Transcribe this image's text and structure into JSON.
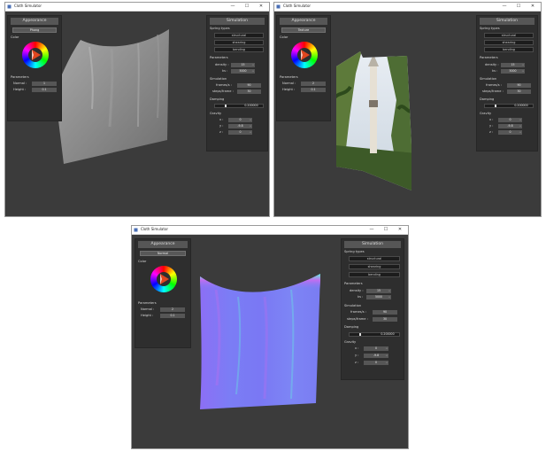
{
  "windows": [
    {
      "title": "Cloth Simulator",
      "shading": "Phong",
      "buttons": {
        "minimize": "—",
        "maximize": "☐",
        "close": "✕"
      },
      "appearance": {
        "title": "Appearance",
        "color_label": "Color",
        "parameters_label": "Parameters",
        "normal_label": "Normal :",
        "normal_value": "1",
        "height_label": "Height :",
        "height_value": "0.1"
      },
      "simulation": {
        "title": "Simulation",
        "spring_types_label": "Spring types",
        "spring_buttons": [
          "structural",
          "shearing",
          "bending"
        ],
        "parameters_label": "Parameters",
        "density_label": "density :",
        "density_value": "15",
        "ks_label": "ks :",
        "ks_value": "5000",
        "simulation_label": "Simulation",
        "frames_label": "frames/s :",
        "frames_value": "90",
        "steps_label": "steps/frame :",
        "steps_value": "30",
        "damping_label": "Damping",
        "damping_value": "0.200000",
        "gravity_label": "Gravity",
        "gravity": [
          {
            "label": "x :",
            "value": "0"
          },
          {
            "label": "y :",
            "value": "-9.8"
          },
          {
            "label": "z :",
            "value": "0"
          }
        ]
      }
    },
    {
      "title": "Cloth Simulator",
      "shading": "Texture",
      "buttons": {
        "minimize": "—",
        "maximize": "☐",
        "close": "✕"
      },
      "appearance": {
        "title": "Appearance",
        "color_label": "Color",
        "parameters_label": "Parameters",
        "normal_label": "Normal :",
        "normal_value": "2",
        "height_label": "Height :",
        "height_value": "0.1"
      },
      "simulation": {
        "title": "Simulation",
        "spring_types_label": "Spring types",
        "spring_buttons": [
          "structural",
          "shearing",
          "bending"
        ],
        "parameters_label": "Parameters",
        "density_label": "density :",
        "density_value": "15",
        "ks_label": "ks :",
        "ks_value": "5000",
        "simulation_label": "Simulation",
        "frames_label": "frames/s :",
        "frames_value": "90",
        "steps_label": "steps/frame :",
        "steps_value": "30",
        "damping_label": "Damping",
        "damping_value": "0.200000",
        "gravity_label": "Gravity",
        "gravity": [
          {
            "label": "x :",
            "value": "0"
          },
          {
            "label": "y :",
            "value": "-9.8"
          },
          {
            "label": "z :",
            "value": "0"
          }
        ]
      }
    },
    {
      "title": "Cloth Simulator",
      "shading": "Normal",
      "buttons": {
        "minimize": "—",
        "maximize": "☐",
        "close": "✕"
      },
      "appearance": {
        "title": "Appearance",
        "color_label": "Color",
        "parameters_label": "Parameters",
        "normal_label": "Normal :",
        "normal_value": "2",
        "height_label": "Height :",
        "height_value": "0.1"
      },
      "simulation": {
        "title": "Simulation",
        "spring_types_label": "Spring types",
        "spring_buttons": [
          "structural",
          "shearing",
          "bending"
        ],
        "parameters_label": "Parameters",
        "density_label": "density :",
        "density_value": "15",
        "ks_label": "ks :",
        "ks_value": "5000",
        "simulation_label": "Simulation",
        "frames_label": "frames/s :",
        "frames_value": "90",
        "steps_label": "steps/frame :",
        "steps_value": "30",
        "damping_label": "Damping",
        "damping_value": "0.200000",
        "gravity_label": "Gravity",
        "gravity": [
          {
            "label": "x :",
            "value": "0"
          },
          {
            "label": "y :",
            "value": "-9.8"
          },
          {
            "label": "z :",
            "value": "0"
          }
        ]
      }
    }
  ],
  "colors": {
    "viewport_bg": "#3b3b3b",
    "panel_bg": "#2e2e2e",
    "panel_title_bg": "#565656",
    "field_bg": "#565656",
    "cloth_phong": "#8a8a8a",
    "cloth_normal_a": "#7b73f5",
    "cloth_normal_b": "#c36cf0",
    "cloth_normal_c": "#63f2e0"
  }
}
